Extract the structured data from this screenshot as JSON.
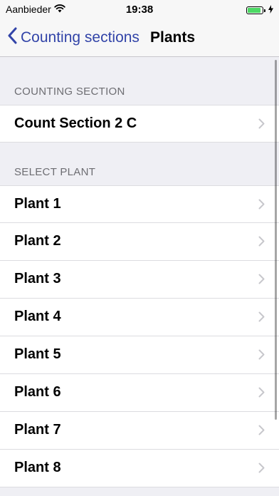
{
  "status_bar": {
    "carrier": "Aanbieder",
    "time": "19:38",
    "battery_level": 0.9,
    "icons": [
      "wifi-icon",
      "battery-icon",
      "charging-bolt-icon"
    ]
  },
  "nav_bar": {
    "back_label": "Counting sections",
    "title": "Plants",
    "accent_color": "#3244a8"
  },
  "sections": [
    {
      "header": "COUNTING SECTION",
      "rows": [
        {
          "label": "Count Section 2 C"
        }
      ]
    },
    {
      "header": "SELECT PLANT",
      "rows": [
        {
          "label": "Plant 1"
        },
        {
          "label": "Plant 2"
        },
        {
          "label": "Plant 3"
        },
        {
          "label": "Plant 4"
        },
        {
          "label": "Plant 5"
        },
        {
          "label": "Plant 6"
        },
        {
          "label": "Plant 7"
        },
        {
          "label": "Plant 8"
        }
      ]
    }
  ]
}
